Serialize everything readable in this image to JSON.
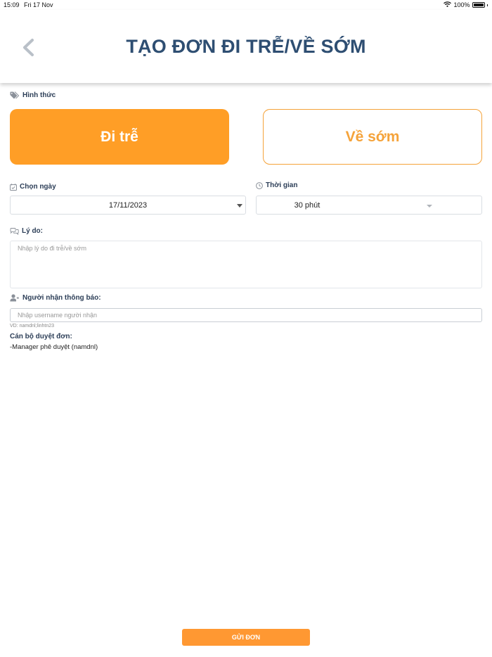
{
  "status_bar": {
    "time": "15:09",
    "date": "Fri 17 Nov",
    "battery": "100%"
  },
  "header": {
    "title": "TẠO ĐƠN ĐI TRỄ/VỀ SỚM"
  },
  "form": {
    "type_label": "Hình thức",
    "type_options": [
      {
        "label": "Đi trễ",
        "selected": true
      },
      {
        "label": "Về sớm",
        "selected": false
      }
    ],
    "date_label": "Chọn ngày",
    "date_value": "17/11/2023",
    "time_label": "Thời gian",
    "time_value": "30 phút",
    "reason_label": "Lý do:",
    "reason_placeholder": "Nhập lý do đi trễ/về sớm",
    "recipient_label": "Người nhận thông báo:",
    "recipient_placeholder": "Nhập username người nhận",
    "recipient_hint": "VD: namdnl;linhtn23",
    "approver_label": "Cán bộ duyệt đơn:",
    "approver_value": "-Manager phê duyệt (namdnl)"
  },
  "submit_label": "GỬI ĐƠN",
  "colors": {
    "accent": "#ff9e26",
    "title": "#2e4e72",
    "border": "#d9dde2"
  }
}
